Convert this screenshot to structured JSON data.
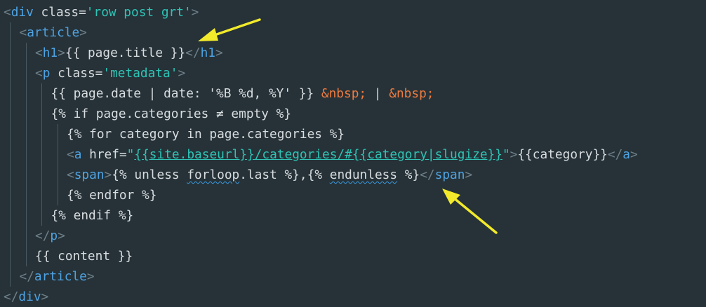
{
  "editor": {
    "lines": [
      {
        "indent": 0,
        "tokens": [
          [
            "br",
            "<"
          ],
          [
            "tag",
            "div"
          ],
          [
            "attr",
            " class="
          ],
          [
            "str",
            "'row post grt'"
          ],
          [
            "br",
            ">"
          ]
        ]
      },
      {
        "indent": 1,
        "tokens": [
          [
            "br",
            "<"
          ],
          [
            "tag",
            "article"
          ],
          [
            "br",
            ">"
          ]
        ]
      },
      {
        "indent": 2,
        "tokens": [
          [
            "br",
            "<"
          ],
          [
            "tag",
            "h1"
          ],
          [
            "br",
            ">"
          ],
          [
            "txt",
            "{{ page.title }}"
          ],
          [
            "br",
            "</"
          ],
          [
            "tag",
            "h1"
          ],
          [
            "br",
            ">"
          ]
        ]
      },
      {
        "indent": 2,
        "tokens": [
          [
            "br",
            "<"
          ],
          [
            "tag",
            "p"
          ],
          [
            "attr",
            " class="
          ],
          [
            "str",
            "'metadata'"
          ],
          [
            "br",
            ">"
          ]
        ]
      },
      {
        "indent": 3,
        "tokens": [
          [
            "txt",
            "{{ page.date | date: '%B %d, %Y' }} "
          ],
          [
            "ent",
            "&nbsp;"
          ],
          [
            "txt",
            " | "
          ],
          [
            "ent",
            "&nbsp;"
          ]
        ]
      },
      {
        "indent": 3,
        "tokens": [
          [
            "txt",
            "{% if page.categories ≠ empty %}"
          ]
        ]
      },
      {
        "indent": 4,
        "tokens": [
          [
            "txt",
            "{% for category in page.categories %}"
          ]
        ]
      },
      {
        "indent": 4,
        "tokens": [
          [
            "br",
            "<"
          ],
          [
            "tag",
            "a"
          ],
          [
            "attr",
            " href="
          ],
          [
            "str",
            "\""
          ],
          [
            "str-u",
            "{{site.baseurl}}/categories/#{{category|slugize}}"
          ],
          [
            "str",
            "\""
          ],
          [
            "br",
            ">"
          ],
          [
            "txt",
            "{{category}}"
          ],
          [
            "br",
            "</"
          ],
          [
            "tag",
            "a"
          ],
          [
            "br",
            ">"
          ]
        ]
      },
      {
        "indent": 4,
        "tokens": [
          [
            "br",
            "<"
          ],
          [
            "tag",
            "span"
          ],
          [
            "br",
            ">"
          ],
          [
            "txt",
            "{% unless "
          ],
          [
            "sq",
            "forloop"
          ],
          [
            "txt",
            ".last %},{% "
          ],
          [
            "sq",
            "endunless"
          ],
          [
            "txt",
            " %}"
          ],
          [
            "br",
            "</"
          ],
          [
            "tag",
            "span"
          ],
          [
            "br",
            ">"
          ]
        ]
      },
      {
        "indent": 4,
        "tokens": [
          [
            "txt",
            "{% endfor %}"
          ]
        ]
      },
      {
        "indent": 3,
        "tokens": [
          [
            "txt",
            "{% endif %}"
          ]
        ]
      },
      {
        "indent": 2,
        "tokens": [
          [
            "br",
            "</"
          ],
          [
            "tag",
            "p"
          ],
          [
            "br",
            ">"
          ]
        ]
      },
      {
        "indent": 2,
        "tokens": [
          [
            "txt",
            "{{ content }}"
          ]
        ]
      },
      {
        "indent": 1,
        "tokens": [
          [
            "br",
            "</"
          ],
          [
            "tag",
            "article"
          ],
          [
            "br",
            ">"
          ]
        ]
      },
      {
        "indent": 0,
        "tokens": [
          [
            "br",
            "</"
          ],
          [
            "tag",
            "div"
          ],
          [
            "br",
            ">"
          ]
        ]
      }
    ]
  },
  "annotations": {
    "arrow_color": "#f2ea2a",
    "arrows": [
      "arrow-pointing-to-h1-line",
      "arrow-pointing-to-endunless"
    ]
  },
  "colors": {
    "background": "#263238",
    "tag": "#4fa3e3",
    "bracket": "#6e7f88",
    "string": "#2ec4b6",
    "entity": "#f07b3f",
    "text": "#d8dde0"
  }
}
